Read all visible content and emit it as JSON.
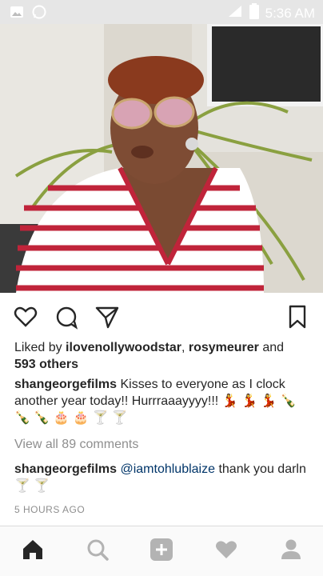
{
  "status_bar": {
    "time": "5:36 AM",
    "icons": [
      "image-icon",
      "whatsapp-icon",
      "signal-icon",
      "battery-icon"
    ]
  },
  "post": {
    "photo_alt": "",
    "actions": [
      "like-icon",
      "comment-icon",
      "share-icon",
      "bookmark-icon"
    ],
    "likes": {
      "prefix": "Liked by ",
      "user1": "ilovenollywoodstar",
      "sep": ", ",
      "user2": "rosymeurer",
      "and": " and",
      "others": "593 others"
    },
    "caption": {
      "username": "shangeorgefilms",
      "text": " Kisses to everyone as I clock another year today!! Hurrraaayyyy!!! 💃 💃 💃 🍾 🍾 🍾 🎂 🎂 🍸 🍸"
    },
    "view_comments": "View all 89 comments",
    "comment": {
      "username": "shangeorgefilms",
      "mention": "@iamtohlublaize",
      "text": " thank you darln 🍸 🍸"
    },
    "time_ago": "5 HOURS AGO"
  },
  "bottom_nav": [
    "home-icon",
    "search-icon",
    "add-icon",
    "activity-icon",
    "profile-icon"
  ],
  "colors": {
    "link": "#003569",
    "muted": "#8e8e8e",
    "text": "#262626"
  }
}
